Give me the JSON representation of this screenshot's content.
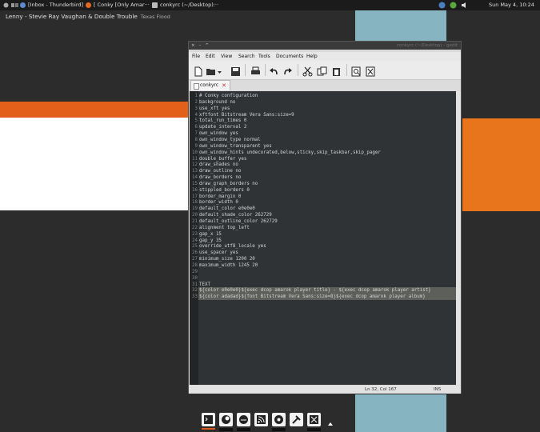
{
  "top_panel": {
    "tasks": [
      "[Inbox - Thunderbird]",
      "[ Conky [Only Amar···",
      "conkyrc (~/Desktop):··"
    ],
    "clock": "Sun May  4, 10:24"
  },
  "conky": {
    "now_playing": "Lenny - Stevie Ray Vaughan & Double Trouble",
    "album": "Texas Flood"
  },
  "window": {
    "title": "conkyrc (~/Desktop) - gedit",
    "menu": [
      "File",
      "Edit",
      "View",
      "Search",
      "Tools",
      "Documents",
      "Help"
    ],
    "toolbar_icons": [
      "new-icon",
      "open-icon",
      "save-icon",
      "print-icon",
      "undo-icon",
      "redo-icon",
      "cut-icon",
      "copy-icon",
      "paste-icon",
      "find-icon",
      "replace-icon"
    ],
    "tab_label": "conkyrc",
    "lines": [
      "# Conky configuration",
      "background no",
      "use_xft yes",
      "xftfont Bitstream Vera Sans:size=9",
      "total_run_times 0",
      "update_interval 2",
      "own_window yes",
      "own_window_type normal",
      "own_window_transparent yes",
      "own_window_hints undecorated,below,sticky,skip_taskbar,skip_pager",
      "double_buffer yes",
      "draw_shades no",
      "draw_outline no",
      "draw_borders no",
      "draw_graph_borders no",
      "stippled_borders 0",
      "border_margin 0",
      "border_width 0",
      "default_color e0e0e0",
      "default_shade_color 262729",
      "default_outline_color 262729",
      "alignment top_left",
      "gap_x 15",
      "gap_y 35",
      "override_utf8_locale yes",
      "use_spacer yes",
      "minimum_size 1200 20",
      "maximum_width 1245 20",
      "",
      "",
      "TEXT",
      "${color e0e0e0}${exec dcop amarok player title} - ${exec dcop amarok player artist}",
      "${color adadad}${font Bitstream Vera Sans:size=8}${exec dcop amarok player album}"
    ],
    "status": {
      "position": "Ln 32, Col 167",
      "mode": "INS"
    }
  },
  "dock": {
    "items": [
      "terminal-icon",
      "firefox-icon",
      "thunderbird-icon",
      "rss-icon",
      "amarok-icon",
      "tools-icon",
      "settings-icon"
    ]
  },
  "colors": {
    "orange": "#e2601a",
    "blue": "#86b4c0",
    "editor_bg": "#2f3336"
  }
}
